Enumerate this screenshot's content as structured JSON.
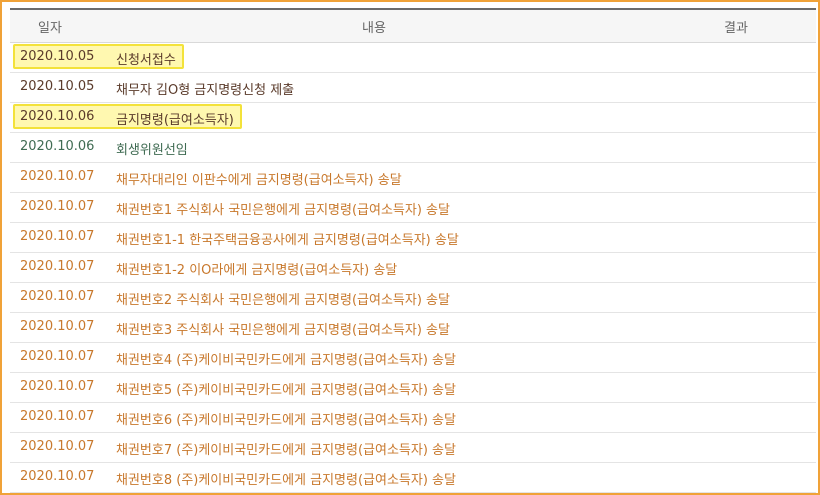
{
  "header": {
    "date": "일자",
    "content": "내용",
    "result": "결과"
  },
  "rows": [
    {
      "date": "2020.10.05",
      "content": "신청서접수",
      "style": "highlight"
    },
    {
      "date": "2020.10.05",
      "content": "채무자 김O형 금지명령신청 제출",
      "style": "dark"
    },
    {
      "date": "2020.10.06",
      "content": "금지명령(급여소득자)",
      "style": "highlight"
    },
    {
      "date": "2020.10.06",
      "content": "회생위원선임",
      "style": "green"
    },
    {
      "date": "2020.10.07",
      "content": "채무자대리인 이판수에게 금지명령(급여소득자) 송달",
      "style": "orange"
    },
    {
      "date": "2020.10.07",
      "content": "채권번호1 주식회사 국민은행에게 금지명령(급여소득자) 송달",
      "style": "orange"
    },
    {
      "date": "2020.10.07",
      "content": "채권번호1-1 한국주택금융공사에게 금지명령(급여소득자) 송달",
      "style": "orange"
    },
    {
      "date": "2020.10.07",
      "content": "채권번호1-2 이O라에게 금지명령(급여소득자) 송달",
      "style": "orange"
    },
    {
      "date": "2020.10.07",
      "content": "채권번호2 주식회사 국민은행에게 금지명령(급여소득자) 송달",
      "style": "orange"
    },
    {
      "date": "2020.10.07",
      "content": "채권번호3 주식회사 국민은행에게 금지명령(급여소득자) 송달",
      "style": "orange"
    },
    {
      "date": "2020.10.07",
      "content": "채권번호4 (주)케이비국민카드에게 금지명령(급여소득자) 송달",
      "style": "orange"
    },
    {
      "date": "2020.10.07",
      "content": "채권번호5 (주)케이비국민카드에게 금지명령(급여소득자) 송달",
      "style": "orange"
    },
    {
      "date": "2020.10.07",
      "content": "채권번호6 (주)케이비국민카드에게 금지명령(급여소득자) 송달",
      "style": "orange"
    },
    {
      "date": "2020.10.07",
      "content": "채권번호7 (주)케이비국민카드에게 금지명령(급여소득자) 송달",
      "style": "orange"
    },
    {
      "date": "2020.10.07",
      "content": "채권번호8 (주)케이비국민카드에게 금지명령(급여소득자) 송달",
      "style": "orange"
    }
  ],
  "colors": {
    "border": "#f0a238",
    "highlight_fill": "#fff8b0",
    "highlight_border": "#f3e23a",
    "text_dark": "#5a3a2a",
    "text_green": "#3f6b52",
    "text_orange": "#c8782c"
  }
}
